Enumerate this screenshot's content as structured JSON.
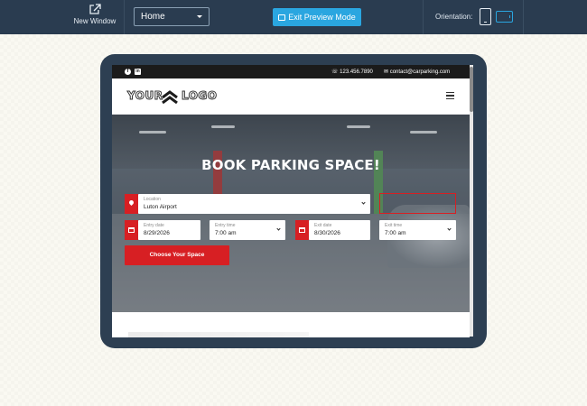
{
  "toolbar": {
    "new_window_label": "New Window",
    "page_select_value": "Home",
    "exit_preview_label": "Exit Preview Mode",
    "orientation_label": "Orientation:"
  },
  "site": {
    "topbar": {
      "phone": "123.456.7890",
      "email": "contact@carparking.com"
    },
    "logo": {
      "text_left": "YOUR",
      "text_right": "LOGO"
    },
    "hero": {
      "title": "BOOK PARKING SPACE!",
      "location": {
        "label": "Location",
        "value": "Luton Airport"
      },
      "entry_date": {
        "label": "Entry date",
        "value": "8/29/2026"
      },
      "entry_time": {
        "label": "Entry time",
        "value": "7:00 am"
      },
      "exit_date": {
        "label": "Exit date",
        "value": "8/30/2026"
      },
      "exit_time": {
        "label": "Exit time",
        "value": "7:00 am"
      },
      "cta_label": "Choose Your Space"
    }
  },
  "colors": {
    "toolbar_bg": "#2a3c50",
    "accent_blue": "#2aa6e0",
    "brand_red": "#d71f23",
    "device_frame": "#2d3f52"
  },
  "icons": [
    "external-link-icon",
    "chevron-down-icon",
    "exit-icon",
    "portrait-tablet-icon",
    "landscape-tablet-icon",
    "facebook-icon",
    "linkedin-icon",
    "phone-icon",
    "mail-icon",
    "hamburger-icon",
    "location-pin-icon",
    "calendar-icon"
  ]
}
